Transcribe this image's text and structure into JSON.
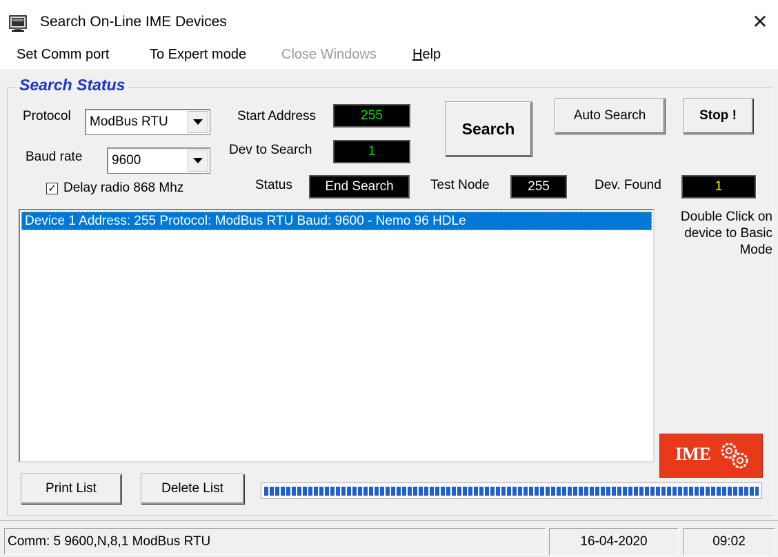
{
  "window": {
    "title": "Search On-Line IME Devices",
    "close_glyph": "✕"
  },
  "menu": {
    "items": [
      {
        "label": "Set Comm port",
        "enabled": true
      },
      {
        "label": "To Expert mode",
        "enabled": true
      },
      {
        "label": "Close Windows",
        "enabled": false
      },
      {
        "label": "Help",
        "enabled": true
      }
    ]
  },
  "search_status": {
    "title": "Search Status",
    "protocol_label": "Protocol",
    "protocol_value": "ModBus RTU",
    "baud_label": "Baud rate",
    "baud_value": "9600",
    "delay_label": "Delay radio 868 Mhz",
    "delay_checked": true,
    "start_address_label": "Start Address",
    "start_address_value": "255",
    "dev_to_search_label": "Dev to Search",
    "dev_to_search_value": "1",
    "status_label": "Status",
    "status_value": "End Search",
    "test_node_label": "Test Node",
    "test_node_value": "255",
    "dev_found_label": "Dev. Found",
    "dev_found_value": "1",
    "colors": {
      "green": "#00e000",
      "yellow": "#ffff00",
      "white": "#ffffff"
    }
  },
  "buttons": {
    "search": "Search",
    "auto_search": "Auto Search",
    "stop": "Stop !",
    "print_list": "Print List",
    "delete_list": "Delete List"
  },
  "device_list": {
    "rows": [
      {
        "text": "Device  1  Address:  255  Protocol: ModBus RTU  Baud: 9600 - Nemo 96 HDLe",
        "selected": true
      }
    ]
  },
  "hint": {
    "line1": "Double Click on",
    "line2": "device to Basic",
    "line3": "Mode"
  },
  "logo": {
    "text": "IME"
  },
  "progress": {
    "fraction": 1.0
  },
  "status_bar": {
    "comm": "Comm: 5   9600,N,8,1   ModBus RTU",
    "date": "16-04-2020",
    "time": "09:02"
  }
}
